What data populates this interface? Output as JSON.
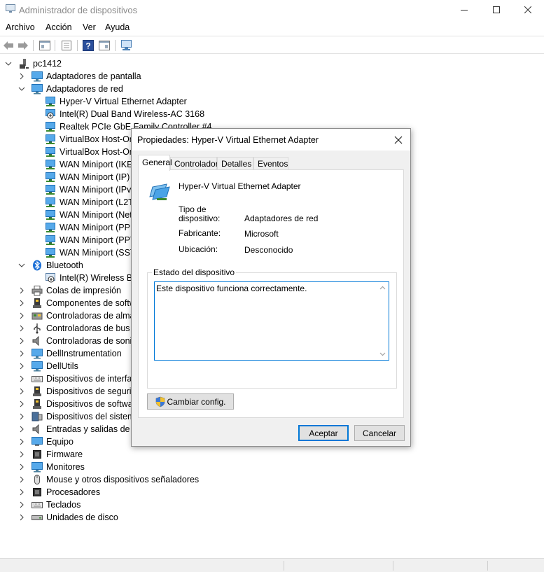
{
  "window": {
    "title": "Administrador de dispositivos"
  },
  "menu": {
    "items": [
      "Archivo",
      "Acción",
      "Ver",
      "Ayuda"
    ]
  },
  "toolbar": {
    "buttons": [
      "back-icon",
      "forward-icon",
      "properties-view-icon",
      "update-driver-icon",
      "help-icon",
      "resources-view-icon",
      "scan-hardware-icon"
    ]
  },
  "tree": {
    "root": "pc1412",
    "categories": [
      {
        "label": "Adaptadores de pantalla",
        "icon": "display-adapter-icon"
      },
      {
        "label": "Adaptadores de red",
        "icon": "network-adapter-icon",
        "expanded": true,
        "children": [
          "Hyper-V Virtual Ethernet Adapter",
          "Intel(R) Dual Band Wireless-AC 3168",
          "Realtek PCIe GbE Family Controller #4",
          "VirtualBox Host-Onl",
          "VirtualBox Host-Onl",
          "WAN Miniport (IKEv",
          "WAN Miniport (IP)",
          "WAN Miniport (IPv6",
          "WAN Miniport (L2TP",
          "WAN Miniport (Netw",
          "WAN Miniport (PPPO",
          "WAN Miniport (PPTP",
          "WAN Miniport (SSTP"
        ]
      },
      {
        "label": "Bluetooth",
        "icon": "bluetooth-icon",
        "expanded": true,
        "children": [
          "Intel(R) Wireless Blue"
        ]
      },
      {
        "label": "Colas de impresión",
        "icon": "printer-icon"
      },
      {
        "label": "Componentes de softw",
        "icon": "software-component-icon"
      },
      {
        "label": "Controladoras de almac",
        "icon": "storage-controller-icon"
      },
      {
        "label": "Controladoras de bus se",
        "icon": "usb-icon"
      },
      {
        "label": "Controladoras de sonido",
        "icon": "speaker-icon"
      },
      {
        "label": "DellInstrumentation",
        "icon": "monitor-icon"
      },
      {
        "label": "DellUtils",
        "icon": "monitor-icon"
      },
      {
        "label": "Dispositivos de interfaz",
        "icon": "hid-icon"
      },
      {
        "label": "Dispositivos de segurid",
        "icon": "security-device-icon"
      },
      {
        "label": "Dispositivos de software",
        "icon": "software-device-icon"
      },
      {
        "label": "Dispositivos del sistema",
        "icon": "system-device-icon"
      },
      {
        "label": "Entradas y salidas de au",
        "icon": "audio-io-icon"
      },
      {
        "label": "Equipo",
        "icon": "computer-icon"
      },
      {
        "label": "Firmware",
        "icon": "firmware-icon"
      },
      {
        "label": "Monitores",
        "icon": "monitor-icon"
      },
      {
        "label": "Mouse y otros dispositivos señaladores",
        "icon": "mouse-icon"
      },
      {
        "label": "Procesadores",
        "icon": "processor-icon"
      },
      {
        "label": "Teclados",
        "icon": "keyboard-icon"
      },
      {
        "label": "Unidades de disco",
        "icon": "disk-drive-icon"
      }
    ]
  },
  "dialog": {
    "title": "Propiedades: Hyper-V Virtual Ethernet Adapter",
    "tabs": [
      "General",
      "Controlador",
      "Detalles",
      "Eventos"
    ],
    "active_tab": "General",
    "device_name": "Hyper-V Virtual Ethernet Adapter",
    "props": {
      "type_label": "Tipo de dispositivo:",
      "type_value": "Adaptadores de red",
      "maker_label": "Fabricante:",
      "maker_value": "Microsoft",
      "location_label": "Ubicación:",
      "location_value": "Desconocido"
    },
    "status_group_label": "Estado del dispositivo",
    "status_text": "Este dispositivo funciona correctamente.",
    "change_button": "Cambiar config.",
    "ok_button": "Aceptar",
    "cancel_button": "Cancelar"
  },
  "colors": {
    "accent": "#0078d7",
    "network_icon": "#2e8bd8"
  }
}
